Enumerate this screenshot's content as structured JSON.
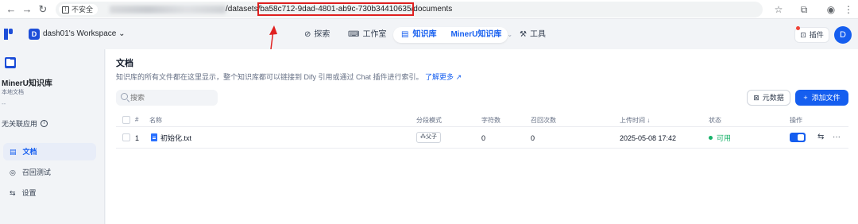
{
  "browser": {
    "insecure_label": "不安全",
    "url_prefix": "/datasets/",
    "url_highlight": "ba58c712-9dad-4801-ab9c-730b34410635",
    "url_suffix": "/documents"
  },
  "header": {
    "workspace_badge": "D",
    "workspace_name": "dash01's Workspace",
    "nav": {
      "explore": "探索",
      "studio": "工作室",
      "knowledge": "知识库",
      "current_dataset": "MinerU知识库",
      "tools": "工具"
    },
    "plugin_label": "插件",
    "avatar_letter": "D"
  },
  "sidebar": {
    "dataset_name": "MinerU知识库",
    "dataset_type": "本地文档",
    "dataset_dash": "--",
    "no_linked_apps": "无关联应用",
    "items": [
      {
        "label": "文档",
        "icon": "document-icon",
        "active": true
      },
      {
        "label": "召回测试",
        "icon": "target-icon",
        "active": false
      },
      {
        "label": "设置",
        "icon": "settings-icon",
        "active": false
      }
    ]
  },
  "main": {
    "title": "文档",
    "description": "知识库的所有文件都在这里显示，整个知识库都可以链接到 Dify 引用或通过 Chat 插件进行索引。",
    "learn_more": "了解更多",
    "search_placeholder": "搜索",
    "metadata_button": "元数据",
    "add_file_button": "添加文件",
    "columns": [
      "#",
      "名称",
      "分段模式",
      "字符数",
      "召回次数",
      "上传时间",
      "状态",
      "操作"
    ],
    "upload_time_sort": "↓",
    "rows": [
      {
        "index": "1",
        "name": "初始化.txt",
        "segment_mode": "父子",
        "chars": "0",
        "recall_count": "0",
        "upload_time": "2025-05-08 17:42",
        "status": "可用",
        "enabled": true
      }
    ]
  },
  "colors": {
    "accent": "#155eef",
    "annotation_red": "#e02020",
    "status_available": "#17b26a"
  }
}
